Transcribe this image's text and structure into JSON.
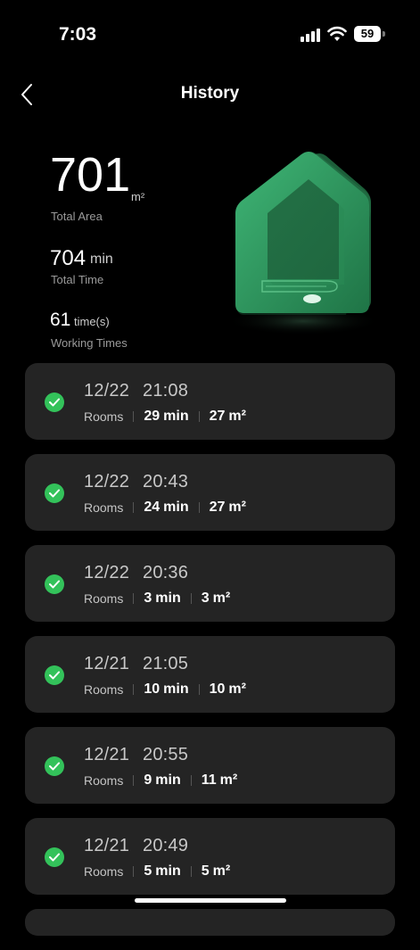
{
  "status": {
    "time": "7:03",
    "battery": "59"
  },
  "header": {
    "title": "History"
  },
  "summary": {
    "area_value": "701",
    "area_unit": "m²",
    "area_label": "Total Area",
    "time_value": "704",
    "time_unit": "min",
    "time_label": "Total Time",
    "work_value": "61",
    "work_unit": "time(s)",
    "work_label": "Working Times"
  },
  "colors": {
    "accent": "#33c25a",
    "card_bg": "#242424",
    "house": "#2e9a5e"
  },
  "records": [
    {
      "date": "12/22",
      "time": "21:08",
      "mode": "Rooms",
      "duration": "29",
      "duration_unit": "min",
      "area": "27",
      "area_unit": "m²"
    },
    {
      "date": "12/22",
      "time": "20:43",
      "mode": "Rooms",
      "duration": "24",
      "duration_unit": "min",
      "area": "27",
      "area_unit": "m²"
    },
    {
      "date": "12/22",
      "time": "20:36",
      "mode": "Rooms",
      "duration": "3",
      "duration_unit": "min",
      "area": "3",
      "area_unit": "m²"
    },
    {
      "date": "12/21",
      "time": "21:05",
      "mode": "Rooms",
      "duration": "10",
      "duration_unit": "min",
      "area": "10",
      "area_unit": "m²"
    },
    {
      "date": "12/21",
      "time": "20:55",
      "mode": "Rooms",
      "duration": "9",
      "duration_unit": "min",
      "area": "11",
      "area_unit": "m²"
    },
    {
      "date": "12/21",
      "time": "20:49",
      "mode": "Rooms",
      "duration": "5",
      "duration_unit": "min",
      "area": "5",
      "area_unit": "m²"
    }
  ]
}
